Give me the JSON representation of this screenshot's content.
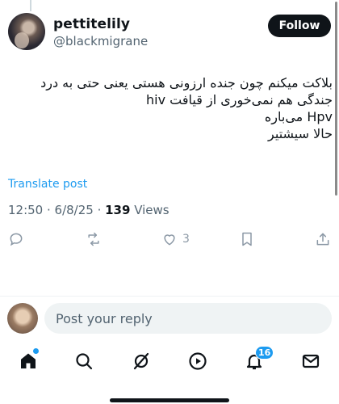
{
  "author": {
    "display_name": "pettitelily",
    "handle": "@blackmigrane",
    "follow_label": "Follow"
  },
  "post": {
    "text": "بلاکت میکنم چون جنده ارزونی هستی یعنی حتی به درد\nجندگی هم نمی‌خوری از قیافت hiv\nHpv  می‌باره\nحالا سیشتیر",
    "translate_label": "Translate post",
    "timestamp": "12:50 · 6/8/25 · ",
    "views_count": "139",
    "views_label": " Views"
  },
  "actions": {
    "likes_count": "3"
  },
  "reply": {
    "placeholder": "Post your reply"
  },
  "nav": {
    "notifications_badge": "16"
  },
  "icons": [
    "reply-icon",
    "repost-icon",
    "like-icon",
    "bookmark-icon",
    "share-icon",
    "home-icon",
    "search-icon",
    "grok-icon",
    "video-icon",
    "notifications-icon",
    "messages-icon"
  ],
  "colors": {
    "accent": "#1d9bf0",
    "text": "#0f1419",
    "secondary_text": "#536471",
    "icon": "#8b98a5"
  }
}
